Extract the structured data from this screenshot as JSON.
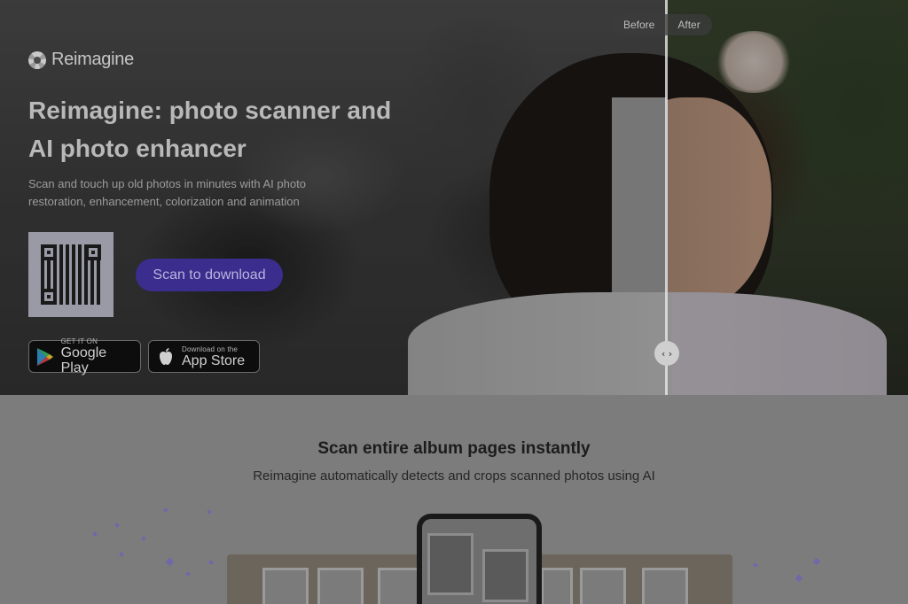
{
  "brand": {
    "name": "Reimagine",
    "logo_icon": "aperture-icon"
  },
  "hero": {
    "title": "Reimagine: photo scanner and AI photo enhancer",
    "subtitle": "Scan and touch up old photos in minutes with AI photo restoration, enhancement, colorization and animation",
    "scan_button": "Scan to download",
    "before_label": "Before",
    "after_label": "After",
    "slider_handle": "‹ ›"
  },
  "stores": {
    "google_play": {
      "small": "GET IT ON",
      "big": "Google Play",
      "icon": "google-play-icon"
    },
    "app_store": {
      "small": "Download on the",
      "big": "App Store",
      "icon": "apple-icon"
    }
  },
  "section": {
    "title": "Scan entire album pages instantly",
    "subtitle": "Reimagine automatically detects and crops scanned photos using AI"
  },
  "colors": {
    "accent": "#3a2d8e",
    "overlay": "rgba(0,0,0,0.3)"
  }
}
